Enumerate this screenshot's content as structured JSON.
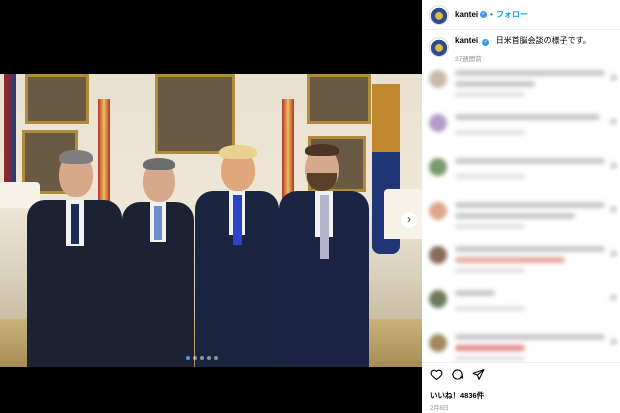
{
  "post": {
    "username": "kantei",
    "follow_label": "フォロー",
    "separator": "•",
    "caption": "日米首脳会談の様子です。",
    "caption_time": "37週間前",
    "likes": "いいね！4836件",
    "date": "2月8日"
  },
  "carousel": {
    "next_glyph": "›",
    "slide_count": 5,
    "active_slide": 1
  },
  "icons": [
    "heart-icon",
    "comment-icon",
    "share-icon"
  ],
  "colors": {
    "follow": "#0095f6",
    "verified": "#3897f0",
    "active_dot": "#4a9bff"
  }
}
